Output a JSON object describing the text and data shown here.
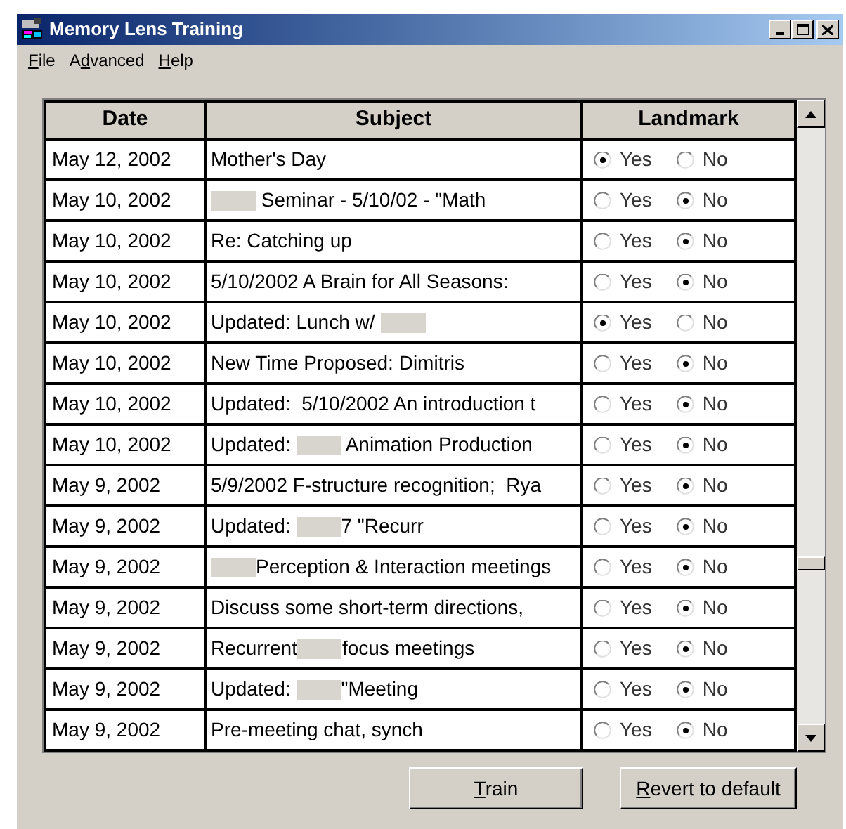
{
  "window": {
    "title": "Memory Lens Training"
  },
  "menu": [
    {
      "accel": "F",
      "after": "ile"
    },
    {
      "before": "A",
      "accel": "d",
      "after": "vanced"
    },
    {
      "accel": "H",
      "after": "elp"
    }
  ],
  "table": {
    "columns": [
      "Date",
      "Subject",
      "Landmark"
    ],
    "rows": [
      {
        "date": "May 12, 2002",
        "subject": [
          {
            "kind": "text",
            "text": "Mother's Day"
          }
        ],
        "options": [
          {
            "label": "Yes",
            "selected": true
          },
          {
            "label": "No",
            "selected": false
          }
        ]
      },
      {
        "date": "May 10, 2002",
        "subject": [
          {
            "kind": "redacted"
          },
          {
            "kind": "text",
            "text": " Seminar - 5/10/02 - \"Math"
          }
        ],
        "options": [
          {
            "label": "Yes",
            "selected": false
          },
          {
            "label": "No",
            "selected": true
          }
        ]
      },
      {
        "date": "May 10, 2002",
        "subject": [
          {
            "kind": "text",
            "text": "Re: Catching up"
          }
        ],
        "options": [
          {
            "label": "Yes",
            "selected": false
          },
          {
            "label": "No",
            "selected": true
          }
        ]
      },
      {
        "date": "May 10, 2002",
        "subject": [
          {
            "kind": "text",
            "text": "5/10/2002 A Brain for All Seasons:"
          }
        ],
        "options": [
          {
            "label": "Yes",
            "selected": false
          },
          {
            "label": "No",
            "selected": true
          }
        ]
      },
      {
        "date": "May 10, 2002",
        "subject": [
          {
            "kind": "text",
            "text": "Updated: Lunch w/ "
          },
          {
            "kind": "redacted"
          }
        ],
        "options": [
          {
            "label": "Yes",
            "selected": true
          },
          {
            "label": "No",
            "selected": false
          }
        ]
      },
      {
        "date": "May 10, 2002",
        "subject": [
          {
            "kind": "text",
            "text": "New Time Proposed: Dimitris"
          }
        ],
        "options": [
          {
            "label": "Yes",
            "selected": false
          },
          {
            "label": "No",
            "selected": true
          }
        ]
      },
      {
        "date": "May 10, 2002",
        "subject": [
          {
            "kind": "text",
            "text": "Updated:  5/10/2002 An introduction t"
          }
        ],
        "options": [
          {
            "label": "Yes",
            "selected": false
          },
          {
            "label": "No",
            "selected": true
          }
        ]
      },
      {
        "date": "May 10, 2002",
        "subject": [
          {
            "kind": "text",
            "text": "Updated: "
          },
          {
            "kind": "redacted"
          },
          {
            "kind": "text",
            "text": " Animation Production"
          }
        ],
        "options": [
          {
            "label": "Yes",
            "selected": false
          },
          {
            "label": "No",
            "selected": true
          }
        ]
      },
      {
        "date": "May 9, 2002",
        "subject": [
          {
            "kind": "text",
            "text": "5/9/2002 F-structure recognition;  Rya"
          }
        ],
        "options": [
          {
            "label": "Yes",
            "selected": false
          },
          {
            "label": "No",
            "selected": true
          }
        ]
      },
      {
        "date": "May 9, 2002",
        "subject": [
          {
            "kind": "text",
            "text": "Updated: "
          },
          {
            "kind": "redacted"
          },
          {
            "kind": "text",
            "text": "7 \"Recurr"
          }
        ],
        "options": [
          {
            "label": "Yes",
            "selected": false
          },
          {
            "label": "No",
            "selected": true
          }
        ]
      },
      {
        "date": "May 9, 2002",
        "subject": [
          {
            "kind": "redacted"
          },
          {
            "kind": "text",
            "text": "Perception & Interaction meetings"
          }
        ],
        "options": [
          {
            "label": "Yes",
            "selected": false
          },
          {
            "label": "No",
            "selected": true
          }
        ]
      },
      {
        "date": "May 9, 2002",
        "subject": [
          {
            "kind": "text",
            "text": "Discuss some short-term directions,"
          }
        ],
        "options": [
          {
            "label": "Yes",
            "selected": false
          },
          {
            "label": "No",
            "selected": true
          }
        ]
      },
      {
        "date": "May 9, 2002",
        "subject": [
          {
            "kind": "text",
            "text": "Recurrent"
          },
          {
            "kind": "redacted"
          },
          {
            "kind": "text",
            "text": "focus meetings"
          }
        ],
        "options": [
          {
            "label": "Yes",
            "selected": false
          },
          {
            "label": "No",
            "selected": true
          }
        ]
      },
      {
        "date": "May 9, 2002",
        "subject": [
          {
            "kind": "text",
            "text": "Updated: "
          },
          {
            "kind": "redacted"
          },
          {
            "kind": "text",
            "text": "\"Meeting"
          }
        ],
        "options": [
          {
            "label": "Yes",
            "selected": false
          },
          {
            "label": "No",
            "selected": true
          }
        ]
      },
      {
        "date": "May 9, 2002",
        "subject": [
          {
            "kind": "text",
            "text": "Pre-meeting chat, synch"
          }
        ],
        "options": [
          {
            "label": "Yes",
            "selected": false
          },
          {
            "label": "No",
            "selected": true
          }
        ]
      }
    ]
  },
  "buttons": [
    {
      "accel": "T",
      "after": "rain"
    },
    {
      "accel": "R",
      "after": "evert to default"
    }
  ]
}
